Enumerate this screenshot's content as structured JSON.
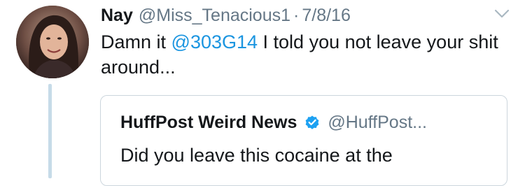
{
  "tweet": {
    "author_name": "Nay",
    "author_handle": "@Miss_Tenacious1",
    "separator": "·",
    "date": "7/8/16",
    "text_before_mention": "Damn it ",
    "mention": "@303G14",
    "text_after_mention": " I told you not leave your shit around...",
    "avatar_icon": "profile-photo",
    "menu_icon": "chevron-down-icon"
  },
  "quoted_tweet": {
    "author_name": "HuffPost Weird News",
    "verified_icon": "verified-badge-icon",
    "author_handle": "@HuffPost...",
    "text": "Did you leave this cocaine at the"
  },
  "colors": {
    "link": "#1b95e0",
    "secondary_text": "#657786",
    "thread_line": "#c6dbe8",
    "border": "#ccd6dd"
  }
}
